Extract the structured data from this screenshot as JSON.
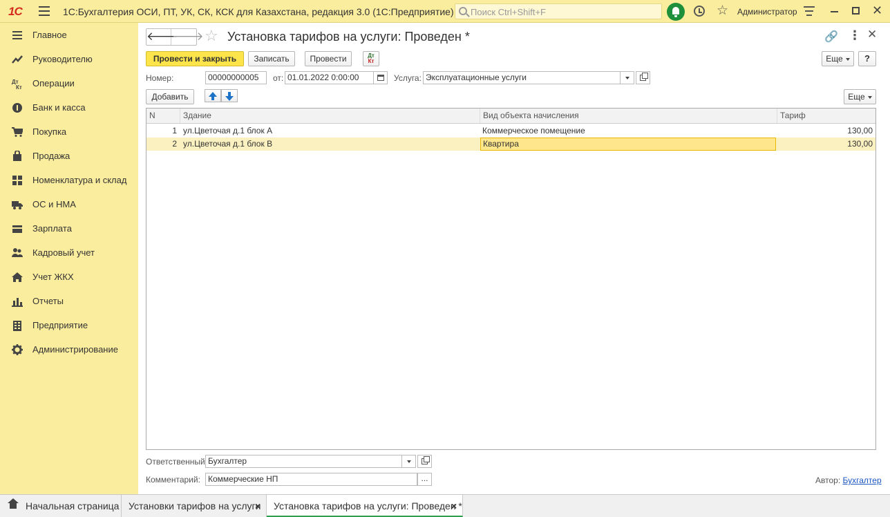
{
  "app": {
    "logo": "1С",
    "title": "1С:Бухгалтерия ОСИ, ПТ, УК, СК, КСК для Казахстана, редакция 3.0  (1С:Предприятие)",
    "search_placeholder": "Поиск Ctrl+Shift+F",
    "user": "Администратор"
  },
  "sidebar": {
    "items": [
      {
        "label": "Главное",
        "icon": "menu-icon"
      },
      {
        "label": "Руководителю",
        "icon": "trend-icon"
      },
      {
        "label": "Операции",
        "icon": "dt-kt-icon"
      },
      {
        "label": "Банк и касса",
        "icon": "coins-icon"
      },
      {
        "label": "Покупка",
        "icon": "cart-icon"
      },
      {
        "label": "Продажа",
        "icon": "bag-icon"
      },
      {
        "label": "Номенклатура и склад",
        "icon": "grid-icon"
      },
      {
        "label": "ОС и НМА",
        "icon": "truck-icon"
      },
      {
        "label": "Зарплата",
        "icon": "wallet-icon"
      },
      {
        "label": "Кадровый учет",
        "icon": "people-icon"
      },
      {
        "label": "Учет ЖКХ",
        "icon": "house-icon"
      },
      {
        "label": "Отчеты",
        "icon": "bar-chart-icon"
      },
      {
        "label": "Предприятие",
        "icon": "building-icon"
      },
      {
        "label": "Администрирование",
        "icon": "gear-icon"
      }
    ]
  },
  "form": {
    "title": "Установка тарифов на услуги: Проведен *",
    "toolbar": {
      "post_close": "Провести и закрыть",
      "save": "Записать",
      "post": "Провести",
      "dt": "Дт",
      "kt": "Кт",
      "more": "Еще",
      "help": "?"
    },
    "number_label": "Номер:",
    "number_value": "00000000005",
    "date_label": "от:",
    "date_value": "01.01.2022  0:00:00",
    "service_label": "Услуга:",
    "service_value": "Эксплуатационные услуги",
    "add_button": "Добавить",
    "table_more": "Еще",
    "table": {
      "columns": [
        "N",
        "Здание",
        "Вид объекта начисления",
        "Тариф"
      ],
      "rows": [
        {
          "n": "1",
          "building": "ул.Цветочая д.1 блок А",
          "kind": "Коммерческое помещение",
          "tariff": "130,00"
        },
        {
          "n": "2",
          "building": "ул.Цветочая д.1 блок В",
          "kind": "Квартира",
          "tariff": "130,00"
        }
      ]
    },
    "responsible_label": "Ответственный:",
    "responsible_value": "Бухгалтер",
    "comment_label": "Комментарий:",
    "comment_value": "Коммерческие НП",
    "comment_btn": "...",
    "author_label": "Автор:",
    "author_value": "Бухгалтер"
  },
  "tabs": [
    {
      "label": "Начальная страница"
    },
    {
      "label": "Установки тарифов на услуги",
      "close": "×"
    },
    {
      "label": "Установка тарифов на услуги: Проведен *",
      "close": "×"
    }
  ],
  "colors": {
    "panel": "#fbed9e",
    "primary_button": "#fce44a",
    "active_tab_accent": "#2e9d4c",
    "selected_row": "#fbf0c0",
    "link": "#1b56c4"
  }
}
